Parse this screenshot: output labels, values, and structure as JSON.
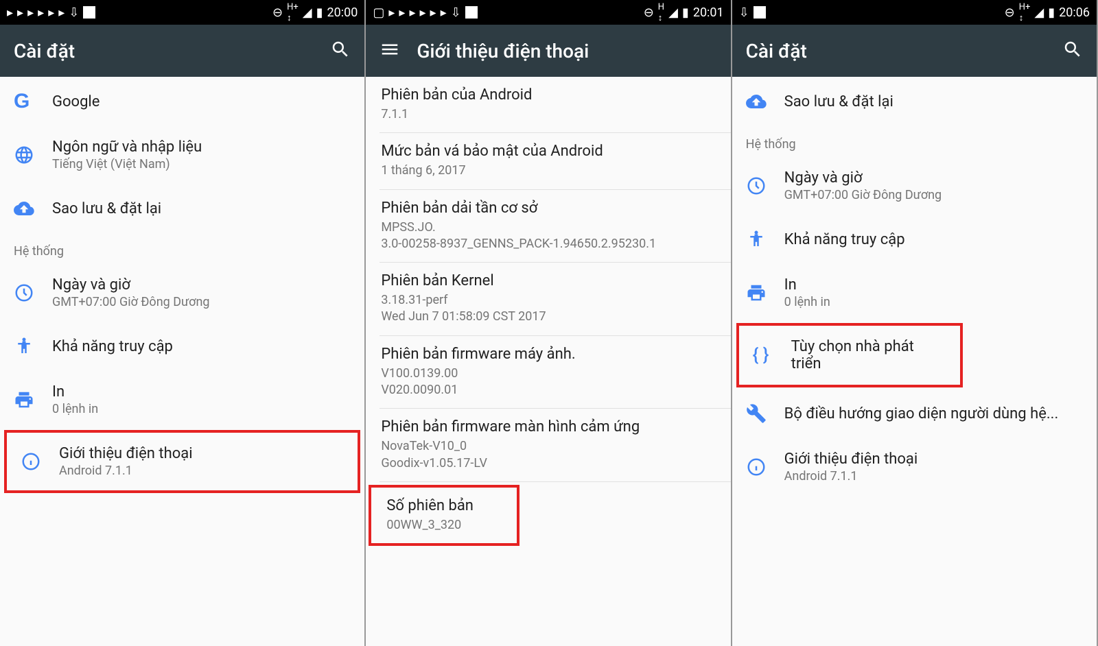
{
  "screens": {
    "s1": {
      "status_time": "20:00",
      "title": "Cài đặt",
      "items": [
        {
          "primary": "Google",
          "secondary": ""
        },
        {
          "primary": "Ngôn ngữ và nhập liệu",
          "secondary": "Tiếng Việt (Việt Nam)"
        },
        {
          "primary": "Sao lưu & đặt lại",
          "secondary": ""
        }
      ],
      "subheader": "Hệ thống",
      "system_items": [
        {
          "primary": "Ngày và giờ",
          "secondary": "GMT+07:00 Giờ Đông Dương"
        },
        {
          "primary": "Khả năng truy cập",
          "secondary": ""
        },
        {
          "primary": "In",
          "secondary": "0 lệnh in"
        },
        {
          "primary": "Giới thiệu điện thoại",
          "secondary": "Android 7.1.1"
        }
      ]
    },
    "s2": {
      "status_time": "20:01",
      "title": "Giới thiệu điện thoại",
      "items": [
        {
          "primary": "Phiên bản của Android",
          "secondary": "7.1.1"
        },
        {
          "primary": "Mức bản vá bảo mật của Android",
          "secondary": "1 tháng 6, 2017"
        },
        {
          "primary": "Phiên bản dải tần cơ sở",
          "secondary": "MPSS.JO.\n3.0-00258-8937_GENNS_PACK-1.94650.2.95230.1"
        },
        {
          "primary": "Phiên bản Kernel",
          "secondary": "3.18.31-perf\nWed Jun 7 01:58:09 CST 2017"
        },
        {
          "primary": "Phiên bản firmware máy ảnh.",
          "secondary": "V100.0139.00\nV020.0090.01"
        },
        {
          "primary": "Phiên bản firmware màn hình cảm ứng",
          "secondary": "NovaTek-V10_0\nGoodix-v1.05.17-LV"
        },
        {
          "primary": "Số phiên bản",
          "secondary": "00WW_3_320"
        }
      ]
    },
    "s3": {
      "status_time": "20:06",
      "title": "Cài đặt",
      "items": [
        {
          "primary": "Sao lưu & đặt lại",
          "secondary": ""
        }
      ],
      "subheader": "Hệ thống",
      "system_items": [
        {
          "primary": "Ngày và giờ",
          "secondary": "GMT+07:00 Giờ Đông Dương"
        },
        {
          "primary": "Khả năng truy cập",
          "secondary": ""
        },
        {
          "primary": "In",
          "secondary": "0 lệnh in"
        },
        {
          "primary": "Tùy chọn nhà phát triển",
          "secondary": ""
        },
        {
          "primary": "Bộ điều hướng giao diện người dùng hệ...",
          "secondary": ""
        },
        {
          "primary": "Giới thiệu điện thoại",
          "secondary": "Android 7.1.1"
        }
      ]
    }
  }
}
